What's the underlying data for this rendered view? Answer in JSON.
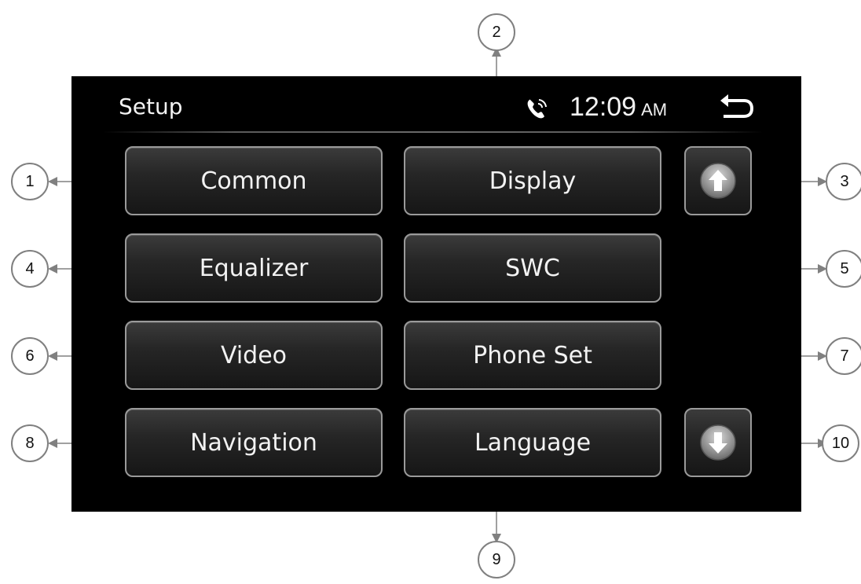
{
  "header": {
    "title": "Setup",
    "time": "12:09",
    "ampm": "AM",
    "phone_icon": "phone-icon",
    "back_icon": "back-icon"
  },
  "buttons": {
    "common": "Common",
    "display": "Display",
    "equalizer": "Equalizer",
    "swc": "SWC",
    "video": "Video",
    "phone_set": "Phone Set",
    "navigation": "Navigation",
    "language": "Language"
  },
  "scroll": {
    "up_icon": "arrow-up-icon",
    "down_icon": "arrow-down-icon"
  },
  "callouts": [
    "1",
    "2",
    "3",
    "4",
    "5",
    "6",
    "7",
    "8",
    "9",
    "10"
  ],
  "colors": {
    "screen_bg": "#000000",
    "button_border": "#9a9a9a",
    "text": "#f2f2f2",
    "callout_border": "#808080"
  }
}
